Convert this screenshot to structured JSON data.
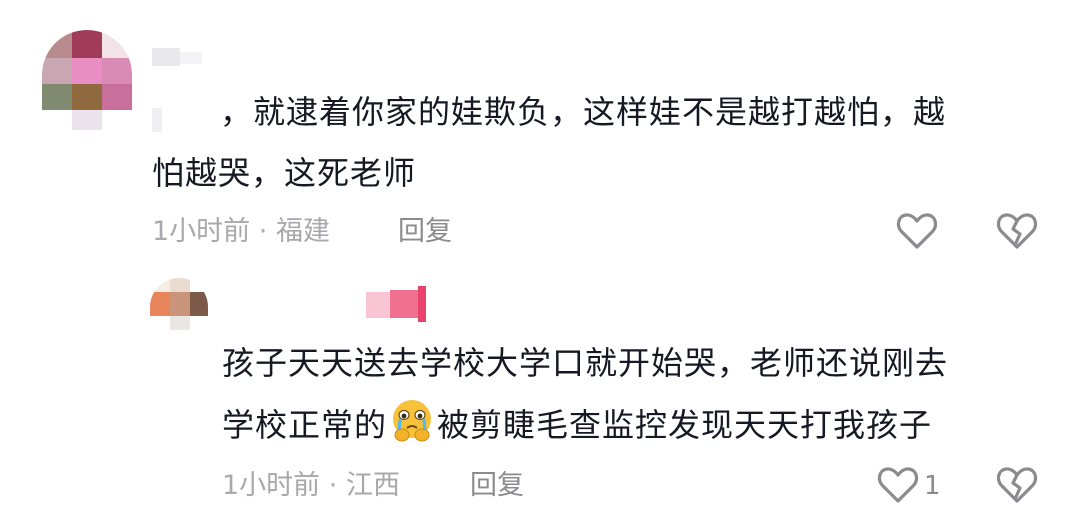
{
  "comments": [
    {
      "text_line1": "，就逮着你家的娃欺负，这样娃不是越打越怕，越",
      "text_line2": "怕越哭，这死老师",
      "time": "1小时前",
      "dot": "·",
      "location": "福建",
      "reply_label": "回复",
      "like_icon": "heart-outline-icon",
      "dislike_icon": "broken-heart-icon"
    },
    {
      "text_line1": "孩子天天送去学校大学口就开始哭，老师还说刚去",
      "text_line2_a": "学校正常的",
      "emoji": "crying-face-hands-emoji",
      "text_line2_b": "被剪睫毛查监控发现天天打我孩子",
      "time": "1小时前",
      "dot": "·",
      "location": "江西",
      "reply_label": "回复",
      "like_count": "1",
      "like_icon": "heart-outline-icon",
      "dislike_icon": "broken-heart-icon"
    }
  ],
  "colors": {
    "text": "#161823",
    "meta": "#a8a8ad",
    "icon": "#8a8a8f"
  }
}
